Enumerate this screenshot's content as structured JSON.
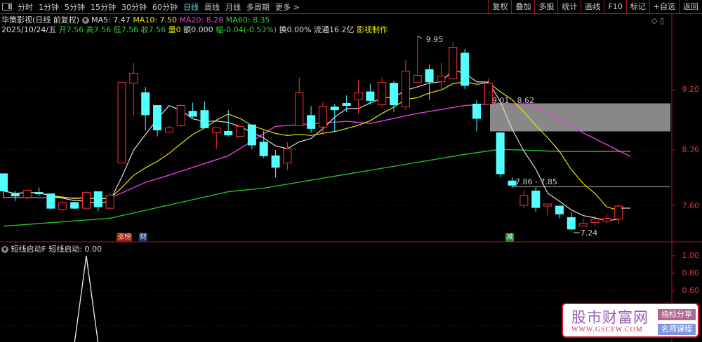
{
  "toolbar": {
    "tabs": [
      "分时",
      "1分钟",
      "5分钟",
      "15分钟",
      "30分钟",
      "60分钟",
      "日线",
      "周线",
      "月线",
      "多周期",
      "更多 >"
    ],
    "active_tab": "日线",
    "buttons": [
      "复权",
      "叠加",
      "多股",
      "统计",
      "画线",
      "F10",
      "标记",
      "+自选",
      "返回"
    ]
  },
  "header": {
    "title": "华策影视(日线 前复权)",
    "ma5": "MA5: 7.47",
    "ma10": "MA10: 7.50",
    "ma20": "MA20: 8.28",
    "ma60": "MA60: 8.35"
  },
  "quote": {
    "date": "2025/10/24/五",
    "open": "开7.56",
    "high": "高7.56",
    "low": "低7.56",
    "close": "收7.56",
    "volume": "量0",
    "amount": "额0.000",
    "change": "幅-0.04(-0.53%)",
    "turnover": "换0.00%",
    "float": "流通16.2亿",
    "industry": "影视制作"
  },
  "price_axis": [
    "9.20",
    "8.36",
    "7.60"
  ],
  "annotations": {
    "high": "9.95",
    "gap_zone": "9.01 - 8.62",
    "gap_line": "7.86 - 7.85",
    "low": "7.24"
  },
  "tags": {
    "limit_up": "涨榜",
    "finance": "财",
    "reduce": "减"
  },
  "indicator": {
    "title": "短线启动F",
    "value_label": "短线启动: 0.00",
    "axis": [
      "1.00",
      "0.80",
      "0.60"
    ],
    "spike_index": 7
  },
  "logo": {
    "name": "股市财富网",
    "url": "WWW.GSCFW.COM",
    "badge1": "指标分享",
    "badge2": "名师课程"
  },
  "colors": {
    "up": "#ff3232",
    "down": "#54ffff",
    "ma5": "#dddddd",
    "ma10": "#e6e600",
    "ma20": "#e040e0",
    "ma60": "#22c022"
  },
  "chart_data": {
    "type": "candlestick",
    "candles": [
      [
        8.03,
        8.03,
        7.69,
        7.79
      ],
      [
        7.75,
        7.79,
        7.65,
        7.72
      ],
      [
        7.7,
        7.81,
        7.67,
        7.8
      ],
      [
        7.77,
        7.84,
        7.72,
        7.75
      ],
      [
        7.75,
        7.75,
        7.54,
        7.55
      ],
      [
        7.53,
        7.65,
        7.51,
        7.63
      ],
      [
        7.63,
        7.64,
        7.54,
        7.55
      ],
      [
        7.55,
        7.79,
        7.55,
        7.77
      ],
      [
        7.78,
        7.79,
        7.51,
        7.57
      ],
      [
        7.55,
        7.76,
        7.55,
        7.73
      ],
      [
        8.18,
        9.3,
        8.18,
        9.3
      ],
      [
        9.29,
        9.57,
        8.84,
        9.43
      ],
      [
        9.16,
        9.24,
        8.63,
        8.85
      ],
      [
        8.98,
        8.98,
        8.55,
        8.64
      ],
      [
        8.61,
        8.7,
        8.61,
        8.67
      ],
      [
        8.7,
        9.0,
        8.68,
        8.98
      ],
      [
        8.9,
        9.02,
        8.81,
        8.83
      ],
      [
        8.91,
        9.04,
        8.67,
        8.67
      ],
      [
        8.6,
        8.67,
        8.38,
        8.67
      ],
      [
        8.62,
        8.92,
        8.55,
        8.57
      ],
      [
        8.55,
        8.69,
        8.55,
        8.69
      ],
      [
        8.71,
        8.71,
        8.37,
        8.43
      ],
      [
        8.47,
        8.63,
        8.25,
        8.28
      ],
      [
        8.28,
        8.36,
        7.98,
        8.12
      ],
      [
        8.18,
        8.47,
        8.08,
        8.38
      ],
      [
        8.7,
        9.37,
        8.7,
        9.16
      ],
      [
        8.84,
        8.97,
        8.6,
        8.66
      ],
      [
        8.68,
        9.03,
        8.57,
        8.97
      ],
      [
        8.96,
        9.0,
        8.61,
        8.92
      ],
      [
        9.01,
        9.12,
        8.89,
        8.98
      ],
      [
        9.06,
        9.33,
        8.86,
        9.16
      ],
      [
        9.17,
        9.28,
        8.99,
        9.05
      ],
      [
        8.99,
        9.37,
        8.95,
        9.3
      ],
      [
        9.29,
        9.32,
        8.89,
        8.99
      ],
      [
        8.96,
        9.61,
        8.92,
        9.46
      ],
      [
        9.3,
        9.95,
        9.3,
        9.4
      ],
      [
        9.48,
        9.55,
        9.06,
        9.31
      ],
      [
        9.31,
        9.57,
        9.2,
        9.39
      ],
      [
        9.35,
        9.86,
        9.35,
        9.79
      ],
      [
        9.71,
        9.77,
        9.21,
        9.26
      ],
      [
        9.0,
        9.06,
        8.62,
        8.8
      ],
      [
        9.0,
        9.36,
        9.0,
        9.29
      ],
      [
        8.6,
        8.61,
        7.98,
        8.03
      ],
      [
        7.93,
        7.98,
        7.84,
        7.87
      ],
      [
        7.59,
        7.8,
        7.55,
        7.73
      ],
      [
        7.79,
        7.84,
        7.5,
        7.56
      ],
      [
        7.58,
        7.61,
        7.45,
        7.61
      ],
      [
        7.58,
        7.58,
        7.41,
        7.47
      ],
      [
        7.42,
        7.49,
        7.24,
        7.26
      ],
      [
        7.3,
        7.41,
        7.3,
        7.34
      ],
      [
        7.35,
        7.45,
        7.3,
        7.4
      ],
      [
        7.37,
        7.47,
        7.34,
        7.41
      ],
      [
        7.4,
        7.6,
        7.34,
        7.58
      ]
    ],
    "ma20": [
      [
        0,
        7.7
      ],
      [
        9,
        7.69
      ],
      [
        12,
        7.91
      ],
      [
        14,
        8.01
      ],
      [
        19,
        8.28
      ],
      [
        23,
        8.69
      ],
      [
        29,
        8.76
      ],
      [
        31,
        8.73
      ],
      [
        35,
        8.87
      ],
      [
        39,
        8.98
      ],
      [
        42,
        9.01
      ],
      [
        44,
        9.0
      ],
      [
        46,
        8.89
      ],
      [
        49,
        8.6
      ],
      [
        53,
        8.27
      ]
    ],
    "ma60": [
      [
        0,
        7.3
      ],
      [
        9,
        7.41
      ],
      [
        19,
        7.78
      ],
      [
        22,
        7.83
      ],
      [
        39,
        8.3
      ],
      [
        42,
        8.37
      ],
      [
        47,
        8.34
      ],
      [
        53,
        8.34
      ]
    ],
    "indicator_values": "0 except 1.00 at candle 7",
    "gap_zone": [
      8.62,
      9.01
    ],
    "gap_line": 7.85
  }
}
